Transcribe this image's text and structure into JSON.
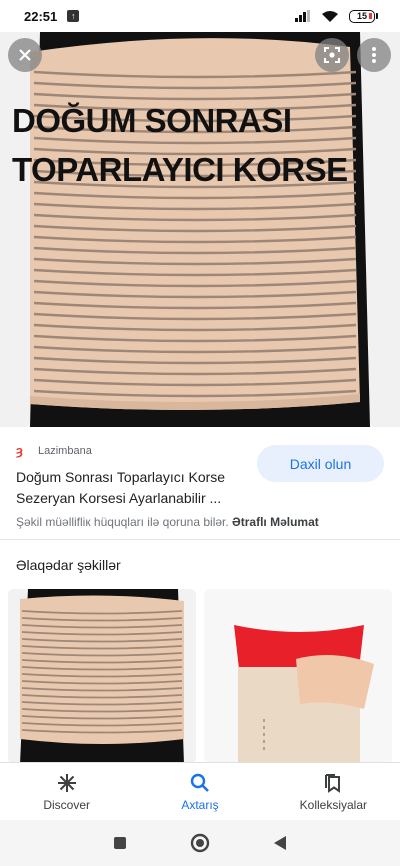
{
  "status_bar": {
    "time": "22:51",
    "battery": "15"
  },
  "hero": {
    "title_line1": "DOĞUM SONRASI",
    "title_line2": "TOPARLAYICI KORSE"
  },
  "result": {
    "source": "Lazimbana",
    "title": "Doğum Sonrası Toparlayıcı Korse Sezeryan Korsesi Ayarlanabilir ...",
    "visit_button": "Daxil olun",
    "copyright_text": "Şəkil müəllifliк hüquqları ilə qoruna bilər.",
    "more_link": "Ətraflı Məlumat"
  },
  "related": {
    "title": "Əlaqədar şəkillər"
  },
  "bottom_nav": {
    "items": [
      {
        "label": "Discover",
        "icon": "asterisk-icon"
      },
      {
        "label": "Axtarış",
        "icon": "search-icon"
      },
      {
        "label": "Kolleksiyalar",
        "icon": "bookmarks-icon"
      }
    ]
  },
  "colors": {
    "accent": "#1a73e8",
    "beige": "#e8c8ae",
    "red": "#e53935"
  }
}
